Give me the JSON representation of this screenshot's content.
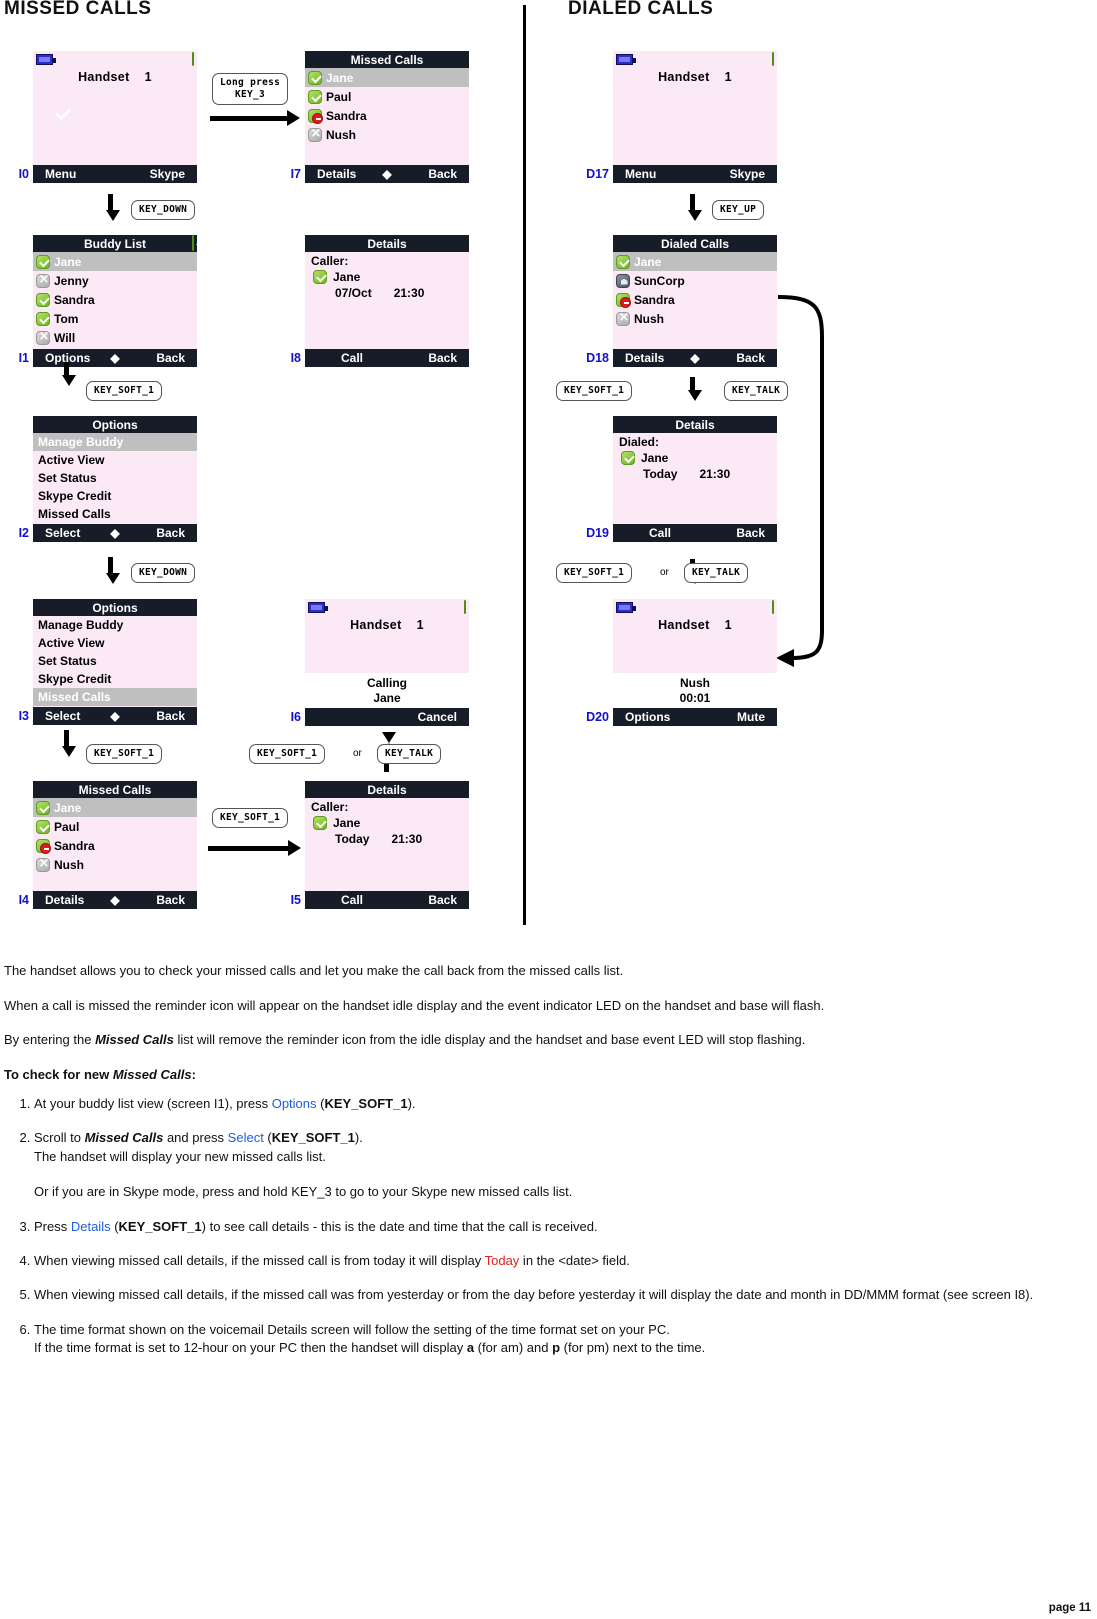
{
  "headings": {
    "missed": "MISSED CALLS",
    "dialed": "DIALED CALLS"
  },
  "colors": {
    "softkey_bar": "#171d28",
    "screen_bg": "#fbe9f6",
    "selection": "#bfbfbf",
    "screen_id": "#1111cc",
    "link_blue": "#1a5fe0",
    "today_red": "#e02020"
  },
  "screens": {
    "I0": {
      "id": "I0",
      "type": "idle",
      "handset_label": "Handset",
      "handset_number": "1",
      "battery_icon": "battery-icon",
      "status_icon": "online-check-icon",
      "reminder_icon": "missed-call-reminder-icon",
      "softkey_left": "Menu",
      "softkey_right": "Skype"
    },
    "I1": {
      "id": "I1",
      "type": "list",
      "title": "Buddy List",
      "title_icon": "online-check-icon",
      "rows": [
        {
          "label": "Jane",
          "icon": "online",
          "selected": true
        },
        {
          "label": "Jenny",
          "icon": "offline",
          "selected": false
        },
        {
          "label": "Sandra",
          "icon": "online",
          "selected": false
        },
        {
          "label": "Tom",
          "icon": "online",
          "selected": false
        },
        {
          "label": "Will",
          "icon": "offline",
          "selected": false
        }
      ],
      "softkey_left": "Options",
      "softkey_mid": "scroll-updown-icon",
      "softkey_right": "Back"
    },
    "I2": {
      "id": "I2",
      "type": "menu",
      "title": "Options",
      "items": [
        {
          "label": "Manage Buddy",
          "selected": true
        },
        {
          "label": "Active View",
          "selected": false
        },
        {
          "label": "Set Status",
          "selected": false
        },
        {
          "label": "Skype Credit",
          "selected": false
        },
        {
          "label": "Missed Calls",
          "selected": false
        }
      ],
      "softkey_left": "Select",
      "softkey_mid": "scroll-updown-icon",
      "softkey_right": "Back"
    },
    "I3": {
      "id": "I3",
      "type": "menu",
      "title": "Options",
      "items": [
        {
          "label": "Manage Buddy",
          "selected": false
        },
        {
          "label": "Active View",
          "selected": false
        },
        {
          "label": "Set Status",
          "selected": false
        },
        {
          "label": "Skype Credit",
          "selected": false
        },
        {
          "label": "Missed Calls",
          "selected": true
        }
      ],
      "softkey_left": "Select",
      "softkey_mid": "scroll-updown-icon",
      "softkey_right": "Back"
    },
    "I4": {
      "id": "I4",
      "type": "list",
      "title": "Missed Calls",
      "rows": [
        {
          "label": "Jane",
          "icon": "online",
          "selected": true
        },
        {
          "label": "Paul",
          "icon": "online",
          "selected": false
        },
        {
          "label": "Sandra",
          "icon": "dnd",
          "selected": false
        },
        {
          "label": "Nush",
          "icon": "offline",
          "selected": false
        }
      ],
      "softkey_left": "Details",
      "softkey_mid": "scroll-updown-icon",
      "softkey_right": "Back"
    },
    "I5": {
      "id": "I5",
      "type": "details",
      "title": "Details",
      "caption": "Caller:",
      "name": "Jane",
      "name_icon": "online",
      "date": "Today",
      "time": "21:30",
      "softkey_left": "Call",
      "softkey_right": "Back"
    },
    "I6": {
      "id": "I6",
      "type": "calling",
      "handset_label": "Handset",
      "handset_number": "1",
      "battery_icon": "battery-icon",
      "status_icon": "online-check-icon",
      "band_icon": "skype-icon",
      "band_line1": "Calling",
      "band_line2": "Jane",
      "softkey_left": "",
      "softkey_right": "Cancel"
    },
    "I7": {
      "id": "I7",
      "type": "list",
      "title": "Missed Calls",
      "rows": [
        {
          "label": "Jane",
          "icon": "online",
          "selected": true
        },
        {
          "label": "Paul",
          "icon": "online",
          "selected": false
        },
        {
          "label": "Sandra",
          "icon": "dnd",
          "selected": false
        },
        {
          "label": "Nush",
          "icon": "offline",
          "selected": false
        }
      ],
      "softkey_left": "Details",
      "softkey_mid": "scroll-updown-icon",
      "softkey_right": "Back"
    },
    "I8": {
      "id": "I8",
      "type": "details",
      "title": "Details",
      "caption": "Caller:",
      "name": "Jane",
      "name_icon": "online",
      "date": "07/Oct",
      "time": "21:30",
      "softkey_left": "Call",
      "softkey_right": "Back"
    },
    "D17": {
      "id": "D17",
      "type": "idle",
      "handset_label": "Handset",
      "handset_number": "1",
      "battery_icon": "battery-icon",
      "status_icon": "online-check-icon",
      "softkey_left": "Menu",
      "softkey_right": "Skype"
    },
    "D18": {
      "id": "D18",
      "type": "list",
      "title": "Dialed Calls",
      "rows": [
        {
          "label": "Jane",
          "icon": "online",
          "selected": true
        },
        {
          "label": "SunCorp",
          "icon": "corp",
          "selected": false
        },
        {
          "label": "Sandra",
          "icon": "dnd",
          "selected": false
        },
        {
          "label": "Nush",
          "icon": "offline",
          "selected": false
        }
      ],
      "softkey_left": "Details",
      "softkey_mid": "scroll-updown-icon",
      "softkey_right": "Back"
    },
    "D19": {
      "id": "D19",
      "type": "details",
      "title": "Details",
      "caption": "Dialed:",
      "name": "Jane",
      "name_icon": "online",
      "date": "Today",
      "time": "21:30",
      "softkey_left": "Call",
      "softkey_right": "Back"
    },
    "D20": {
      "id": "D20",
      "type": "calling",
      "handset_label": "Handset",
      "handset_number": "1",
      "battery_icon": "battery-icon",
      "status_icon": "online-check-icon",
      "band_icon": "skype-icon",
      "band_line1": "Nush",
      "band_line2": "00:01",
      "softkey_left": "Options",
      "softkey_right": "Mute"
    }
  },
  "keys": {
    "long_press_key3": "Long press\nKEY_3",
    "long_press_key3_l1": "Long press",
    "long_press_key3_l2": "KEY_3",
    "key_down": "KEY_DOWN",
    "key_up": "KEY_UP",
    "key_soft_1": "KEY_SOFT_1",
    "key_talk": "KEY_TALK",
    "or": "or"
  },
  "copy": {
    "p1": "The handset allows you to check your missed calls and let you make the call back from the missed calls list.",
    "p2": "When a call is missed the reminder icon will appear on the handset idle display and the event indicator LED on the handset and base will flash.",
    "p3_a": "By entering the ",
    "p3_b": "Missed Calls",
    "p3_c": " list will remove the reminder icon from the idle display and the handset and base event LED will stop flashing.",
    "lead_a": "To check for new ",
    "lead_b": "Missed Calls",
    "lead_c": ":",
    "s1_a": "At your buddy list view (screen I1), press ",
    "s1_link": "Options",
    "s1_b": " (",
    "s1_key": "KEY_SOFT_1",
    "s1_c": ").",
    "s2_a": "Scroll to ",
    "s2_bold": "Missed Calls",
    "s2_b": " and press ",
    "s2_link": "Select",
    "s2_c": " (",
    "s2_key": "KEY_SOFT_1",
    "s2_d": ").",
    "s2_sub1": "The handset will display your new missed calls list.",
    "s2_sub2": "Or if you are in Skype mode, press and hold KEY_3 to go to your Skype new missed calls list.",
    "s3_a": "Press ",
    "s3_link": "Details",
    "s3_b": " (",
    "s3_key": "KEY_SOFT_1",
    "s3_c": ") to see call details - this is the date and time that the call is received.",
    "s4_a": "When viewing missed call details, if the missed call is from today it will display ",
    "s4_red": "Today",
    "s4_b": " in the <date> field.",
    "s5": "When viewing missed call details, if the missed call was from yesterday or from the day before yesterday it will display the date and month in DD/MMM format (see screen I8).",
    "s6": "The time format shown on the voicemail Details screen will follow the setting of the time format set on your PC.",
    "s6_sub_a": "If the time format is set to 12-hour on your PC then the handset will display ",
    "s6_sub_b": "a",
    "s6_sub_c": " (for am) and ",
    "s6_sub_d": "p",
    "s6_sub_e": " (for pm) next to the time."
  },
  "page_number": "page 11"
}
